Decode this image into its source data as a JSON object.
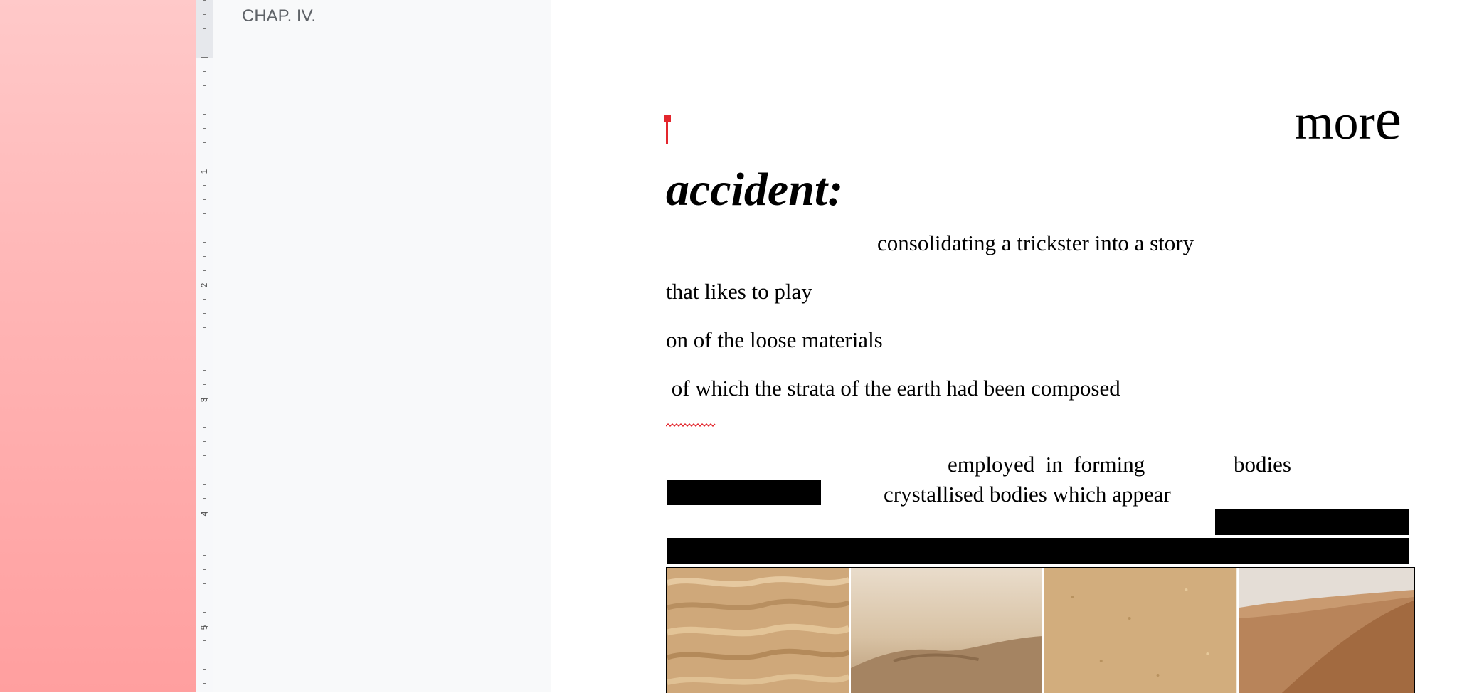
{
  "outline": {
    "items": [
      "CHAP. IV."
    ]
  },
  "ruler": {
    "numbers": [
      "1",
      "2",
      "3",
      "4",
      "5"
    ]
  },
  "document": {
    "more": "mor",
    "more_last": "e",
    "heading": "accident:",
    "lines": [
      "consolidating a trickster into a story",
      "that likes to play",
      "on of the loose materials",
      " of which the strata of the earth had been composed"
    ],
    "row1_a": "employed  in  forming",
    "row1_b": "bodies",
    "row2": "crystallised bodies which appear"
  },
  "images": [
    {
      "name": "rippled-sand-image"
    },
    {
      "name": "sand-closeup-image"
    },
    {
      "name": "sand-texture-image"
    },
    {
      "name": "desert-dune-image"
    }
  ],
  "colors": {
    "cursor": "#e3262d",
    "left_gradient_top": "#ffc9c9",
    "left_gradient_bottom": "#ff9f9f"
  }
}
